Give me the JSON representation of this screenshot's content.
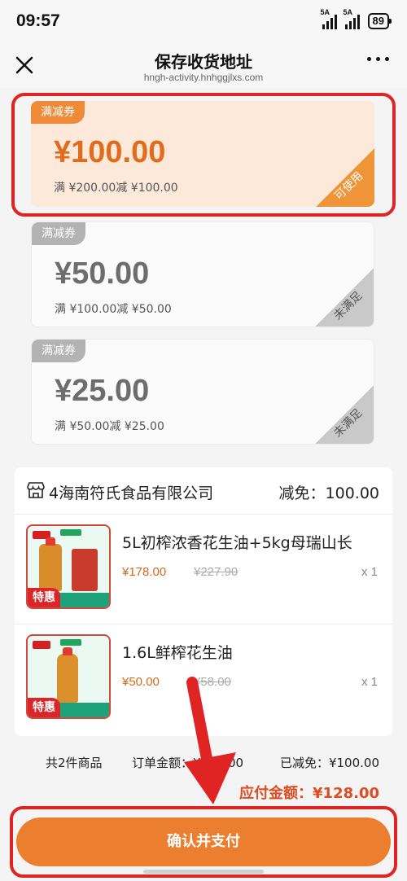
{
  "status_bar": {
    "time": "09:57",
    "signal_1_tag": "5A",
    "signal_2_tag": "5A",
    "battery": "89"
  },
  "header": {
    "title": "保存收货地址",
    "url": "hngh-activity.hnhggjlxs.com"
  },
  "coupons": [
    {
      "tag": "满减券",
      "amount": "¥100.00",
      "condition": "满 ¥200.00减 ¥100.00",
      "status": "可使用"
    },
    {
      "tag": "满减券",
      "amount": "¥50.00",
      "condition": "满 ¥100.00减 ¥50.00",
      "status": "未满足"
    },
    {
      "tag": "满减券",
      "amount": "¥25.00",
      "condition": "满 ¥50.00减 ¥25.00",
      "status": "未满足"
    }
  ],
  "shop": {
    "name": "4海南符氏食品有限公司",
    "discount": "减免：100.00",
    "items": [
      {
        "title": "5L初榨浓香花生油+5kg母瑞山长",
        "price": "¥178.00",
        "original_price": "¥227.90",
        "qty": "x 1",
        "badge": "特惠"
      },
      {
        "title": "1.6L鲜榨花生油",
        "price": "¥50.00",
        "original_price": "¥58.00",
        "qty": "x 1",
        "badge": "特惠"
      }
    ]
  },
  "summary": {
    "count": "共2件商品",
    "order_amount": "订单金额：¥228.00",
    "reduced": "已减免：¥100.00",
    "payable": "应付金额：¥128.00"
  },
  "pay_button": "确认并支付",
  "colors": {
    "accent": "#ec7f2f",
    "annotation": "#e02424",
    "price": "#d46a1a"
  },
  "icons": {
    "close": "close-icon",
    "more": "more-icon",
    "shop": "shop-icon"
  }
}
